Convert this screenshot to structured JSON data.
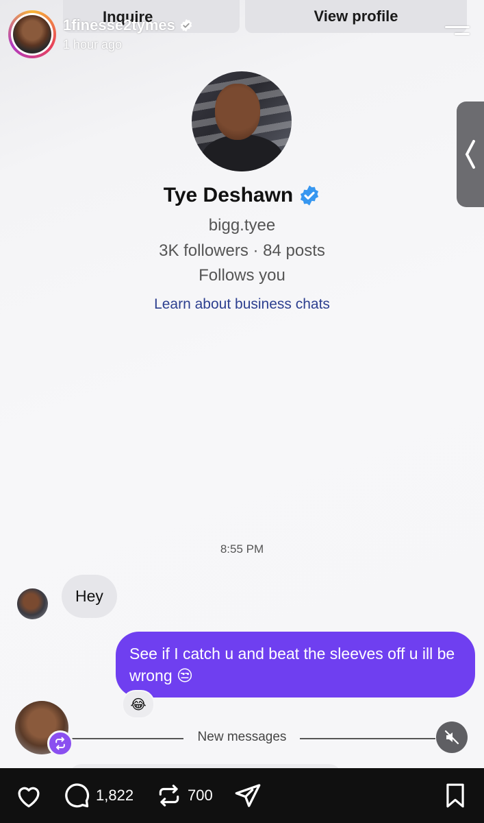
{
  "story": {
    "username": "1finesse2tymes",
    "time_ago": "1 hour ago",
    "inquire_label": "Inquire",
    "view_profile_label": "View profile"
  },
  "profile": {
    "name": "Tye Deshawn",
    "handle": "bigg.tyee",
    "stats": "3K followers · 84 posts",
    "follows_you": "Follows you",
    "learn_link": "Learn about business chats"
  },
  "chat": {
    "timestamp": "8:55 PM",
    "incoming": "Hey",
    "outgoing": "See if I catch u and beat the sleeves off u ill be wrong 😒",
    "reaction": "😂",
    "new_messages": "New messages"
  },
  "bottom_bar": {
    "comments_count": "1,822",
    "reposts_count": "700"
  },
  "colors": {
    "outgoing_bubble": "#6f3ff0",
    "incoming_bubble": "#e6e6ea",
    "link": "#2c3f8f",
    "verified": "#3797f0",
    "bottom_bar": "#101010"
  }
}
